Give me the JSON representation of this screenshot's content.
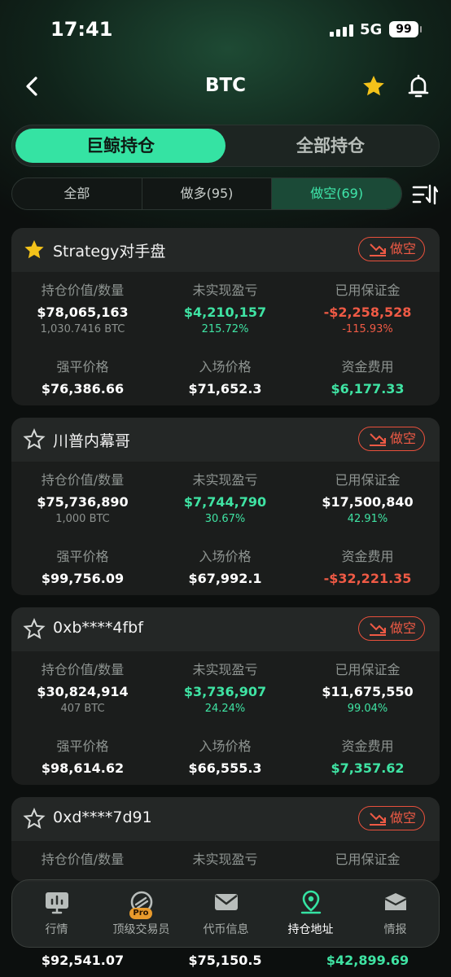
{
  "status": {
    "time": "17:41",
    "network": "5G",
    "battery": "99"
  },
  "header": {
    "title": "BTC",
    "back_icon": "chevron-left-icon",
    "star_icon": "star-filled-icon",
    "bell_icon": "bell-icon"
  },
  "main_tabs": [
    {
      "label": "巨鲸持仓",
      "active": true
    },
    {
      "label": "全部持仓",
      "active": false
    }
  ],
  "sub_tabs": [
    {
      "label": "全部"
    },
    {
      "label": "做多(95)"
    },
    {
      "label": "做空(69)",
      "active": true
    }
  ],
  "labels": {
    "position_value": "持仓价值/数量",
    "unrealized_pnl": "未实现盈亏",
    "margin_used": "已用保证金",
    "liq_price": "强平价格",
    "entry_price": "入场价格",
    "funding_fee": "资金费用",
    "short_badge": "做空"
  },
  "colors": {
    "accent": "#35e3a3",
    "positive": "#3fe3a3",
    "negative": "#ef5a45"
  },
  "cards": [
    {
      "name": "Strategy对手盘",
      "starred": true,
      "position_value": "$78,065,163",
      "quantity": "1,030.7416 BTC",
      "pnl": "$4,210,157",
      "pnl_pct": "215.72%",
      "margin": "-$2,258,528",
      "margin_pct": "-115.93%",
      "liq_price": "$76,386.66",
      "entry_price": "$71,652.3",
      "funding_fee": "$6,177.33"
    },
    {
      "name": "川普内幕哥",
      "starred": false,
      "position_value": "$75,736,890",
      "quantity": "1,000 BTC",
      "pnl": "$7,744,790",
      "pnl_pct": "30.67%",
      "margin": "$17,500,840",
      "margin_pct": "42.91%",
      "liq_price": "$99,756.09",
      "entry_price": "$67,992.1",
      "funding_fee": "-$32,221.35"
    },
    {
      "name": "0xb****4fbf",
      "starred": false,
      "position_value": "$30,824,914",
      "quantity": "407 BTC",
      "pnl": "$3,736,907",
      "pnl_pct": "24.24%",
      "margin": "$11,675,550",
      "margin_pct": "99.04%",
      "liq_price": "$98,614.62",
      "entry_price": "$66,555.3",
      "funding_fee": "$7,357.62"
    },
    {
      "name": "0xd****7d91",
      "starred": false,
      "liq_price": "$92,541.07",
      "entry_price": "$75,150.5",
      "funding_fee": "$42,899.69"
    }
  ],
  "bottom_nav": [
    {
      "label": "行情",
      "icon": "chart-board-icon"
    },
    {
      "label": "顶级交易员",
      "icon": "pro-trader-icon",
      "badge": "Pro"
    },
    {
      "label": "代币信息",
      "icon": "mail-icon"
    },
    {
      "label": "持仓地址",
      "icon": "location-pin-icon",
      "active": true
    },
    {
      "label": "情报",
      "icon": "inbox-icon"
    }
  ]
}
